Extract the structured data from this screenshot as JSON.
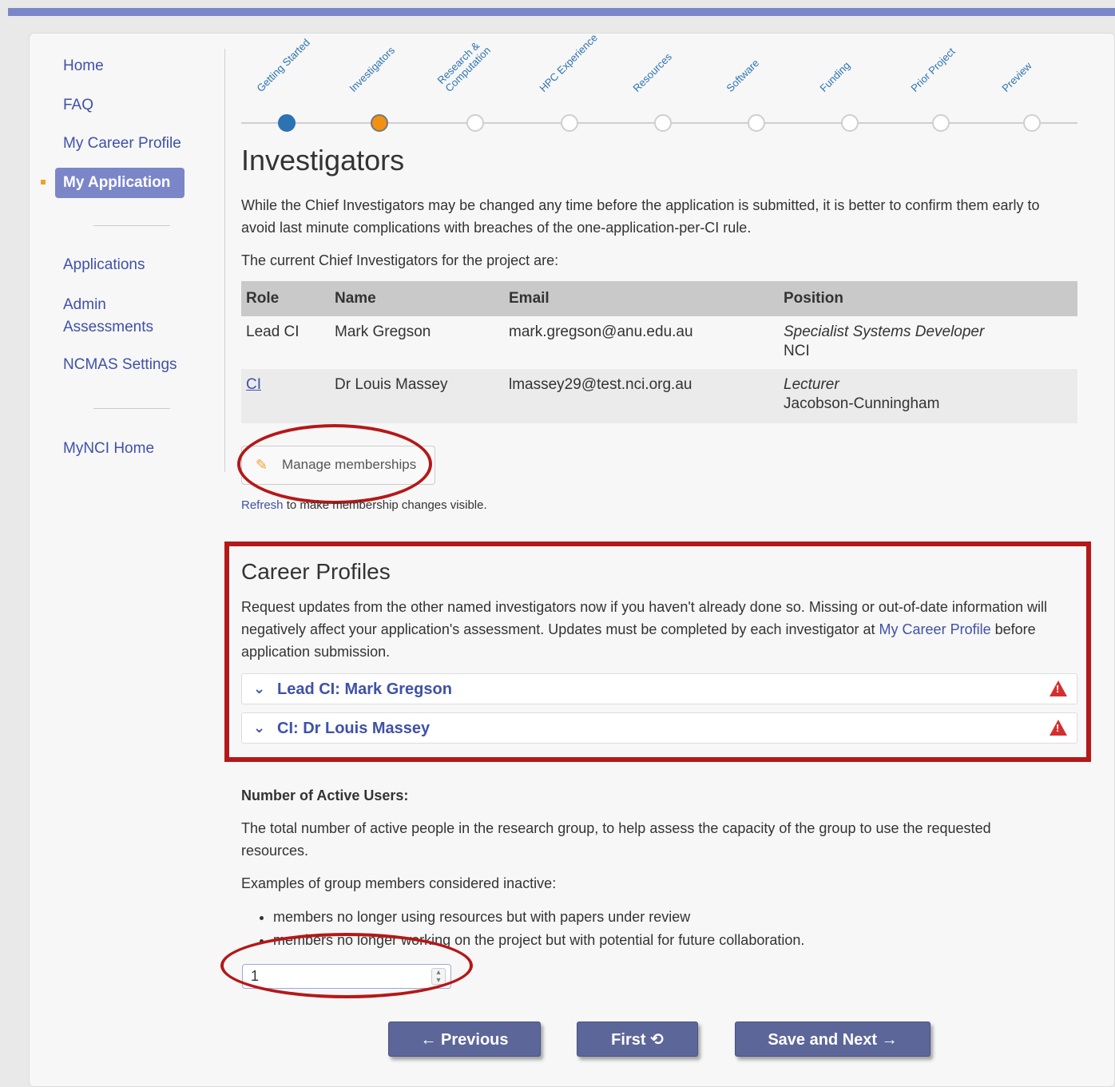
{
  "sidebar": {
    "items": [
      {
        "label": "Home"
      },
      {
        "label": "FAQ"
      },
      {
        "label": "My Career Profile"
      },
      {
        "label": "My Application"
      },
      {
        "label": "Applications"
      },
      {
        "label": "Admin Assessments"
      },
      {
        "label": "NCMAS Settings"
      },
      {
        "label": "MyNCI Home"
      }
    ]
  },
  "stepper": {
    "steps": [
      {
        "label": "Getting Started",
        "state": "done"
      },
      {
        "label": "Investigators",
        "state": "current"
      },
      {
        "label": "Research &\nComputation",
        "state": "todo"
      },
      {
        "label": "HPC Experience",
        "state": "todo"
      },
      {
        "label": "Resources",
        "state": "todo"
      },
      {
        "label": "Software",
        "state": "todo"
      },
      {
        "label": "Funding",
        "state": "todo"
      },
      {
        "label": "Prior Project",
        "state": "todo"
      },
      {
        "label": "Preview",
        "state": "todo"
      }
    ]
  },
  "main": {
    "title": "Investigators",
    "intro": "While the Chief Investigators may be changed any time before the application is submitted, it is better to confirm them early to avoid last minute complications with breaches of the one-application-per-CI rule.",
    "current_ci": "The current Chief Investigators for the project are:",
    "table": {
      "headers": [
        "Role",
        "Name",
        "Email",
        "Position"
      ],
      "rows": [
        {
          "role": "Lead CI",
          "name": "Mark Gregson",
          "email": "mark.gregson@anu.edu.au",
          "position_title": "Specialist Systems Developer",
          "position_org": "NCI"
        },
        {
          "role": "CI",
          "name": "Dr Louis Massey",
          "email": "lmassey29@test.nci.org.au",
          "position_title": "Lecturer",
          "position_org": "Jacobson-Cunningham"
        }
      ]
    },
    "manage_button": "Manage memberships",
    "refresh_link": "Refresh",
    "refresh_text": " to make membership changes visible."
  },
  "career": {
    "title": "Career Profiles",
    "text_before": "Request updates from the other named investigators now if you haven't already done so. Missing or out-of-date information will negatively affect your application's assessment. Updates must be completed by each investigator at ",
    "link": "My Career Profile",
    "text_after": " before application submission.",
    "accordions": [
      {
        "label": "Lead CI: Mark Gregson",
        "icon": "warning-icon"
      },
      {
        "label": "CI: Dr Louis Massey",
        "icon": "warning-icon"
      }
    ]
  },
  "users": {
    "label": "Number of Active Users:",
    "desc": "The total number of active people in the research group, to help assess the capacity of the group to use the requested resources.",
    "examples": "Examples of group members considered inactive:",
    "bullets": [
      "members no longer using resources but with papers under review",
      "members no longer working on the project but with potential for future collaboration."
    ],
    "value": "1"
  },
  "buttons": {
    "previous": "← Previous",
    "first": "First ⟲",
    "save_next": "Save and Next →"
  },
  "colors": {
    "accent": "#7b86c9",
    "link": "#3f51a8",
    "highlight": "#b51818"
  }
}
